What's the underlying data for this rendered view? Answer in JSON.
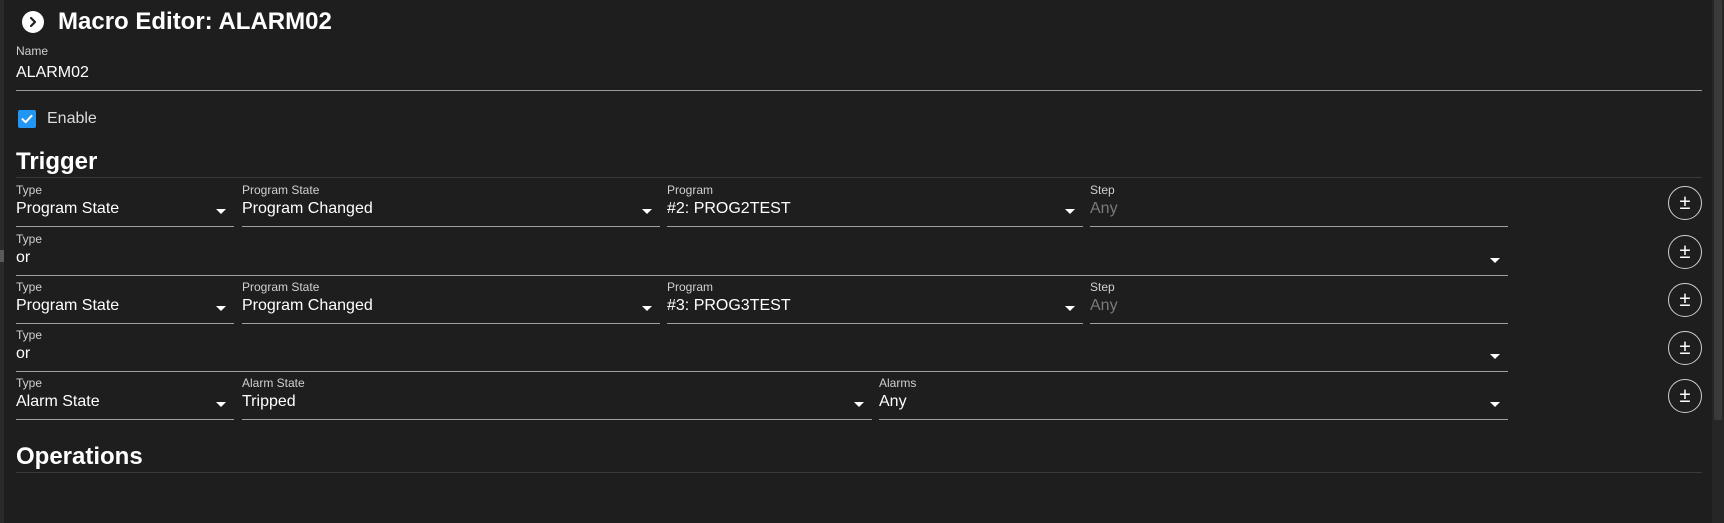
{
  "header": {
    "title": "Macro Editor: ALARM02",
    "back_icon": "chevron-right-icon"
  },
  "name_field": {
    "label": "Name",
    "value": "ALARM02"
  },
  "enable": {
    "label": "Enable",
    "checked": true
  },
  "trigger": {
    "title": "Trigger",
    "rows": [
      {
        "type_label": "Type",
        "type_value": "Program State",
        "state_label": "Program State",
        "state_value": "Program Changed",
        "program_label": "Program",
        "program_value": "#2: PROG2TEST",
        "step_label": "Step",
        "step_placeholder": "Any",
        "add_remove": "±"
      },
      {
        "type_label": "Type",
        "type_value": "or",
        "add_remove": "±"
      },
      {
        "type_label": "Type",
        "type_value": "Program State",
        "state_label": "Program State",
        "state_value": "Program Changed",
        "program_label": "Program",
        "program_value": "#3: PROG3TEST",
        "step_label": "Step",
        "step_placeholder": "Any",
        "add_remove": "±"
      },
      {
        "type_label": "Type",
        "type_value": "or",
        "add_remove": "±"
      },
      {
        "type_label": "Type",
        "type_value": "Alarm State",
        "alarm_state_label": "Alarm State",
        "alarm_state_value": "Tripped",
        "alarms_label": "Alarms",
        "alarms_value": "Any",
        "add_remove": "±"
      }
    ]
  },
  "operations": {
    "title": "Operations"
  },
  "colors": {
    "background": "#1e1e1e",
    "accent": "#2196f3",
    "text": "#ffffff",
    "muted": "#7a7a7a"
  }
}
